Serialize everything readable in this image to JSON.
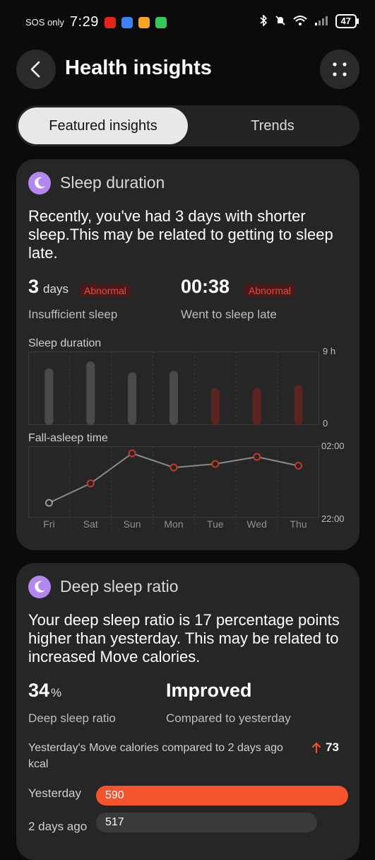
{
  "status_bar": {
    "carrier": "SOS only",
    "time": "7:29",
    "battery": "47",
    "app_icons": [
      {
        "name": "app-icon-red",
        "color": "#e2231a"
      },
      {
        "name": "app-icon-blue",
        "color": "#3b82f6"
      },
      {
        "name": "app-icon-orange",
        "color": "#f5a623"
      },
      {
        "name": "app-icon-green",
        "color": "#34c759"
      }
    ],
    "indicators": [
      "bluetooth-icon",
      "mute-icon",
      "wifi-icon",
      "signal-icon"
    ]
  },
  "header": {
    "title": "Health insights",
    "back_icon": "chevron-left-icon",
    "more_icon": "four-dots-icon"
  },
  "tabs": [
    {
      "label": "Featured insights",
      "active": true
    },
    {
      "label": "Trends",
      "active": false
    }
  ],
  "sleep_card": {
    "title": "Sleep duration",
    "description": "Recently, you've had 3 days with shorter sleep.This may be related to getting to sleep late.",
    "stat1": {
      "value": "3",
      "unit": "days",
      "badge": "Abnormal",
      "label": "Insufficient sleep"
    },
    "stat2": {
      "value": "00:38",
      "badge": "Abnormal",
      "label": "Went to sleep late"
    },
    "duration_chart": {
      "label": "Sleep duration",
      "y_max_label": "9 h",
      "y_min_label": "0"
    },
    "fallasleep_chart": {
      "label": "Fall-asleep time",
      "y_top_label": "02:00",
      "y_bottom_label": "22:00"
    },
    "days": [
      "Fri",
      "Sat",
      "Sun",
      "Mon",
      "Tue",
      "Wed",
      "Thu"
    ]
  },
  "deep_card": {
    "title": "Deep sleep ratio",
    "description": "Your deep sleep ratio is 17 percentage points higher than yesterday. This may be related to increased Move calories.",
    "stat1": {
      "value": "34",
      "unit": "%",
      "label": "Deep sleep ratio"
    },
    "stat2": {
      "value": "Improved",
      "label": "Compared to yesterday"
    },
    "compare_text_line1": "Yesterday's Move calories compared to 2 days ago",
    "compare_text_line2": "kcal",
    "compare_change": "73",
    "compare_icon": "arrow-up-icon",
    "bars": [
      {
        "label": "Yesterday",
        "value": "590"
      },
      {
        "label": "2 days ago",
        "value": "517"
      }
    ]
  },
  "chart_data": [
    {
      "type": "bar",
      "title": "Sleep duration",
      "categories": [
        "Fri",
        "Sat",
        "Sun",
        "Mon",
        "Tue",
        "Wed",
        "Thu"
      ],
      "values": [
        7.2,
        8.1,
        6.7,
        6.9,
        4.7,
        4.7,
        5.1
      ],
      "abnormal": [
        false,
        false,
        false,
        false,
        true,
        true,
        true
      ],
      "ylim": [
        0,
        9
      ],
      "ytick_labels": [
        "0",
        "9 h"
      ],
      "colors": {
        "normal": "#4a4a4a",
        "abnormal": "#5a2520"
      }
    },
    {
      "type": "line",
      "title": "Fall-asleep time",
      "categories": [
        "Fri",
        "Sat",
        "Sun",
        "Mon",
        "Tue",
        "Wed",
        "Thu"
      ],
      "values_hours_after_22": [
        0.8,
        1.9,
        3.6,
        2.8,
        3.0,
        3.4,
        2.9
      ],
      "ylim": [
        0,
        4
      ],
      "ytick_labels": [
        "22:00",
        "02:00"
      ],
      "colors": {
        "line": "#8a8a8a",
        "point": "#c0392b"
      }
    }
  ],
  "colors": {
    "background": "#0b0b0b",
    "card": "#262626",
    "accent_orange": "#f4532c",
    "abnormal_red": "#e14b40",
    "icon_purple": "#b487f0"
  }
}
